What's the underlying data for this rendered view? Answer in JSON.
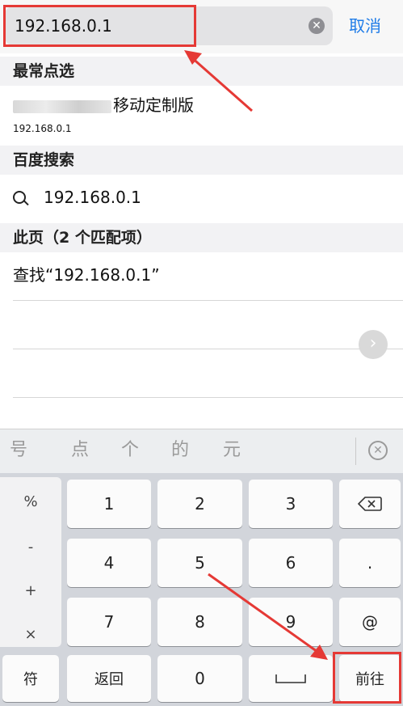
{
  "search_bar": {
    "url_value": "192.168.0.1",
    "clear_icon": "clear-icon",
    "cancel_label": "取消"
  },
  "sections": {
    "frequent_header": "最常点选",
    "baidu_header": "百度搜索",
    "page_header": "此页（2 个匹配项）"
  },
  "frequent_item": {
    "title_suffix": "移动定制版",
    "url": "192.168.0.1"
  },
  "baidu_item": {
    "icon": "search-icon",
    "text": "192.168.0.1"
  },
  "page_item": {
    "text": "查找“192.168.0.1”"
  },
  "candidates": [
    "号",
    "点",
    "个",
    "的",
    "元"
  ],
  "keyboard": {
    "symbols": [
      "%",
      "-",
      "+",
      "×"
    ],
    "row1": [
      "1",
      "2",
      "3"
    ],
    "row2": [
      "4",
      "5",
      "6",
      "."
    ],
    "row3": [
      "7",
      "8",
      "9",
      "@"
    ],
    "bottom": {
      "symbol_key": "符",
      "back_key": "返回",
      "zero_key": "0",
      "enter_key": "前往"
    }
  },
  "colors": {
    "accent": "#1f7ce8",
    "annotation": "#e53935"
  }
}
